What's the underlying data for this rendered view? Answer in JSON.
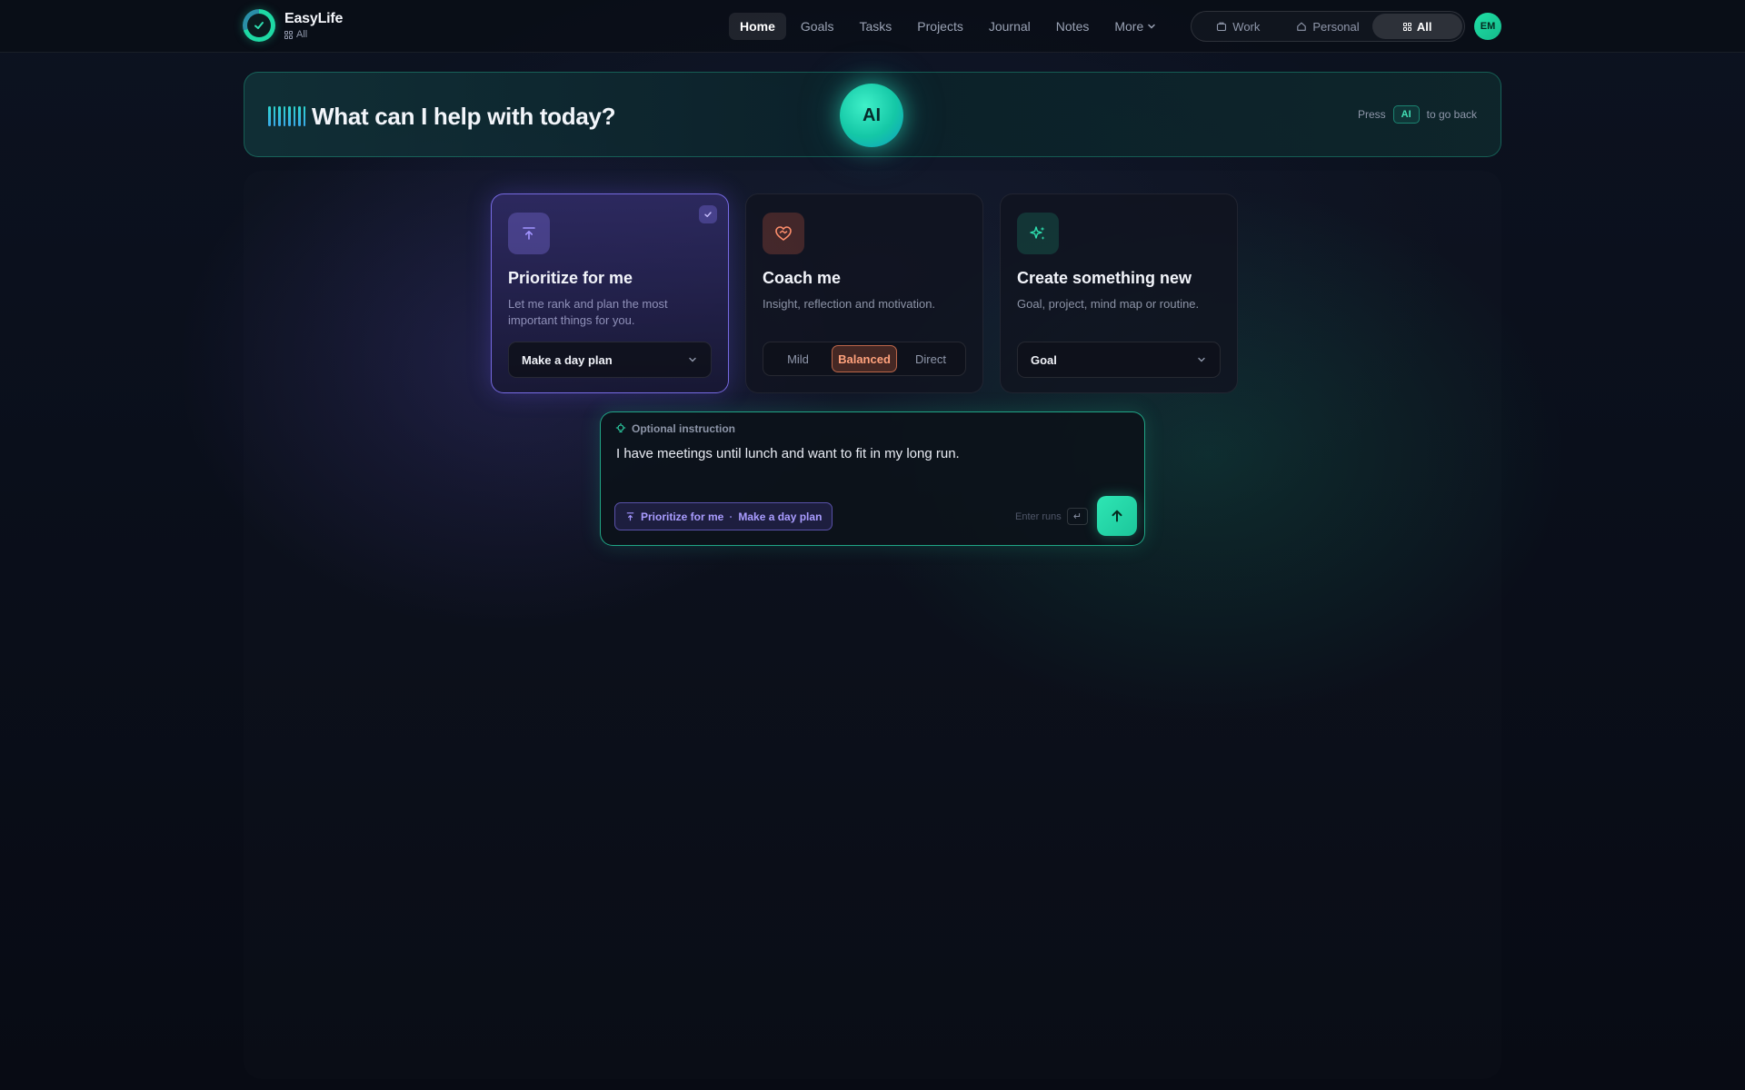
{
  "brand": {
    "name": "EasyLife",
    "scope": "All"
  },
  "nav": {
    "items": [
      {
        "label": "Home",
        "active": true
      },
      {
        "label": "Goals"
      },
      {
        "label": "Tasks"
      },
      {
        "label": "Projects"
      },
      {
        "label": "Journal"
      },
      {
        "label": "Notes"
      }
    ],
    "more_label": "More"
  },
  "context_switch": {
    "options": [
      {
        "label": "Work",
        "icon": "briefcase-icon"
      },
      {
        "label": "Personal",
        "icon": "home-icon"
      },
      {
        "label": "All",
        "icon": "grid-icon",
        "active": true
      }
    ]
  },
  "user": {
    "initials": "EM"
  },
  "hero": {
    "title": "What can I help with today?",
    "orb_label": "AI",
    "hint_prefix": "Press",
    "hint_key": "AI",
    "hint_suffix": "to go back"
  },
  "cards": {
    "prioritize": {
      "title": "Prioritize for me",
      "description": "Let me rank and plan the most important things for you.",
      "select_value": "Make a day plan",
      "selected": true
    },
    "coach": {
      "title": "Coach me",
      "description": "Insight, reflection and motivation.",
      "tones": [
        "Mild",
        "Balanced",
        "Direct"
      ],
      "active_tone": "Balanced"
    },
    "create": {
      "title": "Create something new",
      "description": "Goal, project, mind map or routine.",
      "select_value": "Goal"
    }
  },
  "prompt": {
    "label": "Optional instruction",
    "text": "I have meetings until lunch and want to fit in my long run.",
    "chip_mode": "Prioritize for me",
    "chip_separator": "·",
    "chip_action": "Make a day plan",
    "enter_hint": "Enter runs",
    "enter_key": "↵"
  },
  "colors": {
    "accent_teal": "#1ed9a4",
    "accent_purple": "#8778ff",
    "accent_orange": "#ff9a72",
    "background": "#0a0e18"
  }
}
